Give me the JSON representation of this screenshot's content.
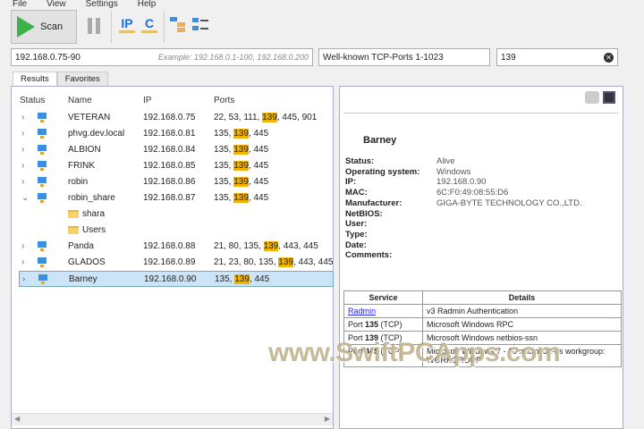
{
  "menu": [
    "File",
    "View",
    "Settings",
    "Help"
  ],
  "toolbar": {
    "scan_label": "Scan",
    "ip_label": "IP",
    "c_label": "C"
  },
  "address": {
    "value": "192.168.0.75-90",
    "example": "Example: 192.168.0.1-100, 192.168.0.200"
  },
  "port_preset": "Well-known TCP-Ports 1-1023",
  "port_filter": "139",
  "tabs": [
    "Results",
    "Favorites"
  ],
  "columns": [
    "Status",
    "Name",
    "IP",
    "Ports"
  ],
  "rows": [
    {
      "name": "VETERAN",
      "ip": "192.168.0.75",
      "pre": "22, 53, 111, ",
      "hl": "139",
      "post": ", 445, 901"
    },
    {
      "name": "phvg.dev.local",
      "ip": "192.168.0.81",
      "pre": "135, ",
      "hl": "139",
      "post": ", 445"
    },
    {
      "name": "ALBION",
      "ip": "192.168.0.84",
      "pre": "135, ",
      "hl": "139",
      "post": ", 445"
    },
    {
      "name": "FRINK",
      "ip": "192.168.0.85",
      "pre": "135, ",
      "hl": "139",
      "post": ", 445"
    },
    {
      "name": "robin",
      "ip": "192.168.0.86",
      "pre": "135, ",
      "hl": "139",
      "post": ", 445"
    },
    {
      "name": "robin_share",
      "ip": "192.168.0.87",
      "pre": "135, ",
      "hl": "139",
      "post": ", 445"
    },
    {
      "name": "Panda",
      "ip": "192.168.0.88",
      "pre": "21, 80, 135, ",
      "hl": "139",
      "post": ", 443, 445"
    },
    {
      "name": "GLADOS",
      "ip": "192.168.0.89",
      "pre": "21, 23, 80, 135, ",
      "hl": "139",
      "post": ", 443, 445"
    },
    {
      "name": "Barney",
      "ip": "192.168.0.90",
      "pre": "135, ",
      "hl": "139",
      "post": ", 445"
    }
  ],
  "shares": [
    "shara",
    "Users"
  ],
  "detail": {
    "title": "Barney",
    "fields": [
      [
        "Status:",
        "Alive"
      ],
      [
        "Operating system:",
        "Windows"
      ],
      [
        "IP:",
        "192.168.0.90"
      ],
      [
        "MAC:",
        "6C:F0:49:08:55:D6"
      ],
      [
        "Manufacturer:",
        "GIGA-BYTE TECHNOLOGY CO.,LTD."
      ],
      [
        "NetBIOS:",
        ""
      ],
      [
        "User:",
        ""
      ],
      [
        "Type:",
        ""
      ],
      [
        "Date:",
        ""
      ],
      [
        "Comments:",
        ""
      ]
    ],
    "service_header": "Service",
    "details_header": "Details",
    "services": [
      {
        "link": "Radmin",
        "details": "v3 Radmin Authentication"
      },
      {
        "pre": "Port ",
        "port": "135",
        "suf": " (TCP)",
        "details": "Microsoft Windows RPC"
      },
      {
        "pre": "Port ",
        "port": "139",
        "suf": " (TCP)",
        "details": "Microsoft Windows netbios-ssn"
      },
      {
        "pre": "Port ",
        "port": "445",
        "suf": " (TCP)",
        "details": "Microsoft Windows 7 - 10 microsoft-ds workgroup: WORKGROUP"
      }
    ]
  },
  "watermark": "www.SwiftPCApps.com"
}
